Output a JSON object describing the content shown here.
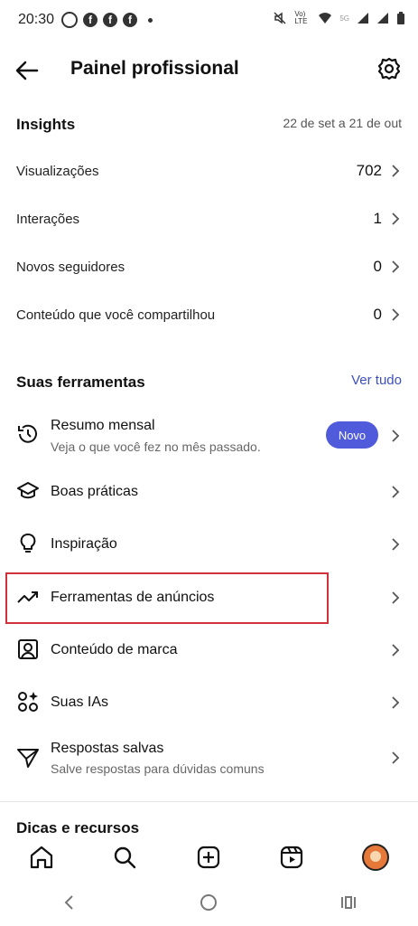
{
  "status_bar": {
    "time": "20:30",
    "network": "Vo) LTE",
    "signal_label": "5G"
  },
  "header": {
    "title": "Painel profissional"
  },
  "insights": {
    "title": "Insights",
    "range": "22 de set a 21 de out",
    "rows": [
      {
        "label": "Visualizações",
        "value": "702"
      },
      {
        "label": "Interações",
        "value": "1"
      },
      {
        "label": "Novos seguidores",
        "value": "0"
      },
      {
        "label": "Conteúdo que você compartilhou",
        "value": "0"
      }
    ]
  },
  "tools": {
    "title": "Suas ferramentas",
    "see_all": "Ver tudo",
    "items": [
      {
        "label": "Resumo mensal",
        "sub": "Veja o que você fez no mês passado.",
        "badge": "Novo",
        "icon": "history-icon"
      },
      {
        "label": "Boas práticas",
        "icon": "graduation-cap-icon"
      },
      {
        "label": "Inspiração",
        "icon": "lightbulb-icon"
      },
      {
        "label": "Ferramentas de anúncios",
        "icon": "trending-up-icon"
      },
      {
        "label": "Conteúdo de marca",
        "icon": "branded-content-icon"
      },
      {
        "label": "Suas IAs",
        "icon": "ai-sparkle-icon"
      },
      {
        "label": "Respostas salvas",
        "sub": "Salve respostas para dúvidas comuns",
        "icon": "send-icon"
      }
    ]
  },
  "tips": {
    "title": "Dicas e recursos"
  },
  "colors": {
    "accent": "#4f5bdb",
    "link": "#3b4fbf",
    "highlight": "#d0313b"
  }
}
